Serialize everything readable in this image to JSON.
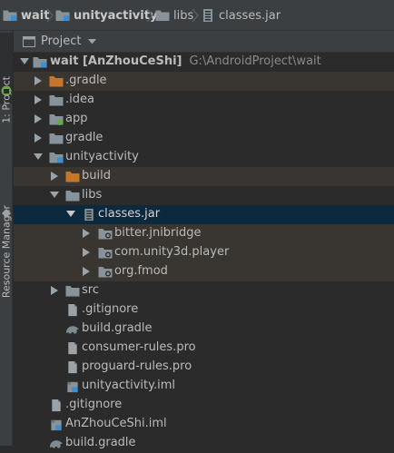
{
  "breadcrumb": [
    {
      "label": "wait",
      "icon": "module-folder-icon"
    },
    {
      "label": "unityactivity",
      "icon": "module-folder-icon"
    },
    {
      "label": "libs",
      "icon": "folder-icon"
    },
    {
      "label": "classes.jar",
      "icon": "jar-icon"
    }
  ],
  "sidebar": {
    "project_tab": "1: Project",
    "resource_tab": "Resource Manager"
  },
  "panel": {
    "title": "Project",
    "dropdown_icon": "caret-down-icon"
  },
  "tree": {
    "root": {
      "label": "wait [AnZhouCeShi]",
      "path": "G:\\AndroidProject\\wait"
    },
    "items": [
      {
        "label": ".gradle",
        "icon": "folder-orange-icon"
      },
      {
        "label": ".idea",
        "icon": "folder-icon"
      },
      {
        "label": "app",
        "icon": "module-folder-icon"
      },
      {
        "label": "gradle",
        "icon": "folder-icon"
      },
      {
        "label": "unityactivity",
        "icon": "module-folder-icon"
      },
      {
        "label": "build",
        "icon": "folder-orange-icon"
      },
      {
        "label": "libs",
        "icon": "folder-icon"
      },
      {
        "label": "classes.jar",
        "icon": "jar-icon"
      },
      {
        "label": "bitter.jnibridge",
        "icon": "package-icon"
      },
      {
        "label": "com.unity3d.player",
        "icon": "package-icon"
      },
      {
        "label": "org.fmod",
        "icon": "package-icon"
      },
      {
        "label": "src",
        "icon": "folder-icon"
      },
      {
        "label": ".gitignore",
        "icon": "file-icon"
      },
      {
        "label": "build.gradle",
        "icon": "gradle-icon"
      },
      {
        "label": "consumer-rules.pro",
        "icon": "file-icon"
      },
      {
        "label": "proguard-rules.pro",
        "icon": "file-icon"
      },
      {
        "label": "unityactivity.iml",
        "icon": "iml-icon"
      },
      {
        "label": ".gitignore",
        "icon": "file-icon"
      },
      {
        "label": "AnZhouCeShi.iml",
        "icon": "iml-icon"
      },
      {
        "label": "build.gradle",
        "icon": "gradle-icon"
      }
    ]
  },
  "colors": {
    "background": "#2b2b2b",
    "toolbar": "#3c3f41",
    "selection": "#0d293e",
    "ignored_highlight": "#393631",
    "text": "#bbbbbb",
    "path_text": "#8a8a8a"
  }
}
